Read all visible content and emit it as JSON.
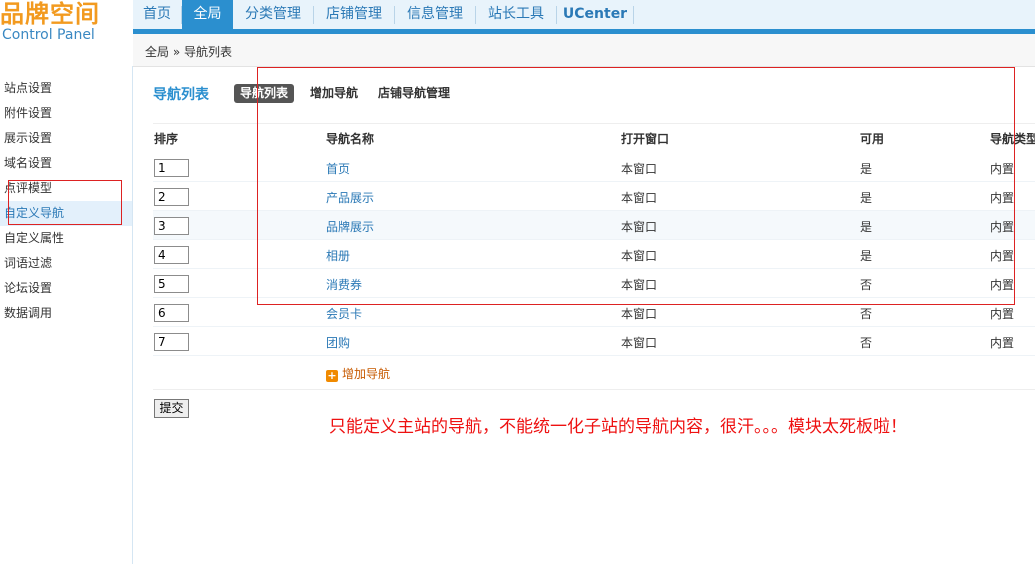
{
  "logo": {
    "brand": "品牌空间",
    "subtitle": "Control Panel"
  },
  "topnav": [
    {
      "label": "首页",
      "active": false
    },
    {
      "label": "全局",
      "active": true
    },
    {
      "label": "分类管理",
      "active": false
    },
    {
      "label": "店铺管理",
      "active": false
    },
    {
      "label": "信息管理",
      "active": false
    },
    {
      "label": "站长工具",
      "active": false
    },
    {
      "label": "UCenter",
      "active": false
    }
  ],
  "breadcrumb": "全局 » 导航列表",
  "sidebar": {
    "items": [
      {
        "label": "站点设置"
      },
      {
        "label": "附件设置"
      },
      {
        "label": "展示设置"
      },
      {
        "label": "域名设置"
      },
      {
        "label": "点评模型"
      },
      {
        "label": "自定义导航",
        "active": true
      },
      {
        "label": "自定义属性"
      },
      {
        "label": "词语过滤"
      },
      {
        "label": "论坛设置"
      },
      {
        "label": "数据调用"
      }
    ]
  },
  "main": {
    "title": "导航列表",
    "tabs": [
      {
        "label": "导航列表",
        "active": true
      },
      {
        "label": "增加导航",
        "active": false
      },
      {
        "label": "店铺导航管理",
        "active": false
      }
    ],
    "table": {
      "headers": [
        "排序",
        "导航名称",
        "打开窗口",
        "可用",
        "导航类型"
      ],
      "rows": [
        {
          "order": "1",
          "name": "首页",
          "window": "本窗口",
          "enabled": "是",
          "type": "内置"
        },
        {
          "order": "2",
          "name": "产品展示",
          "window": "本窗口",
          "enabled": "是",
          "type": "内置"
        },
        {
          "order": "3",
          "name": "品牌展示",
          "window": "本窗口",
          "enabled": "是",
          "type": "内置"
        },
        {
          "order": "4",
          "name": "相册",
          "window": "本窗口",
          "enabled": "是",
          "type": "内置"
        },
        {
          "order": "5",
          "name": "消费券",
          "window": "本窗口",
          "enabled": "否",
          "type": "内置"
        },
        {
          "order": "6",
          "name": "会员卡",
          "window": "本窗口",
          "enabled": "否",
          "type": "内置"
        },
        {
          "order": "7",
          "name": "团购",
          "window": "本窗口",
          "enabled": "否",
          "type": "内置"
        }
      ]
    },
    "add_link": "增加导航",
    "submit_label": "提交"
  },
  "annotation": "只能定义主站的导航，不能统一化子站的导航内容，很汗。。。模块太死板啦！",
  "colors": {
    "accent": "#2b8fcf",
    "brand": "#f29a1f",
    "annotation": "#ee1111"
  }
}
